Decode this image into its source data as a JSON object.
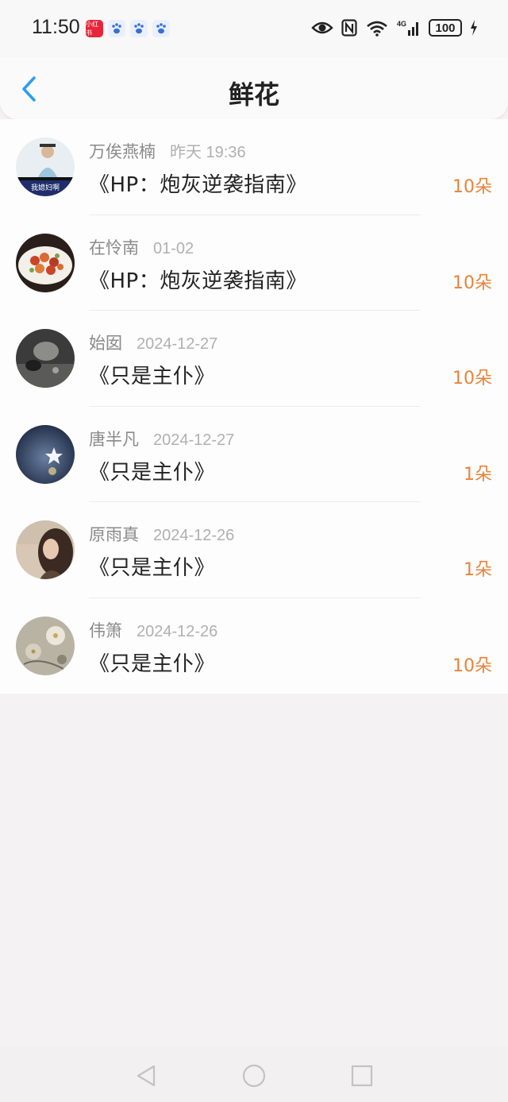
{
  "status_bar": {
    "time": "11:50",
    "app_icon_label": "小红书",
    "battery": "100",
    "icons": [
      "eye-icon",
      "nfc-icon",
      "wifi-icon",
      "signal-icon",
      "battery-icon",
      "charging-icon"
    ]
  },
  "header": {
    "title": "鲜花",
    "back_icon": "chevron-left-icon"
  },
  "items": [
    {
      "name": "万俟燕楠",
      "time": "昨天 19:36",
      "book": "《HP：炮灰逆袭指南》",
      "count": "10朵",
      "avatar_caption": "我媳妇啊"
    },
    {
      "name": "在怜南",
      "time": "01-02",
      "book": "《HP：炮灰逆袭指南》",
      "count": "10朵"
    },
    {
      "name": "始囡",
      "time": "2024-12-27",
      "book": "《只是主仆》",
      "count": "10朵"
    },
    {
      "name": "唐半凡",
      "time": "2024-12-27",
      "book": "《只是主仆》",
      "count": "1朵"
    },
    {
      "name": "原雨真",
      "time": "2024-12-26",
      "book": "《只是主仆》",
      "count": "1朵"
    },
    {
      "name": "伟箫",
      "time": "2024-12-26",
      "book": "《只是主仆》",
      "count": "10朵"
    }
  ],
  "colors": {
    "accent": "#2a9df4",
    "count": "#e8833a",
    "meta": "#8a8a8a"
  }
}
